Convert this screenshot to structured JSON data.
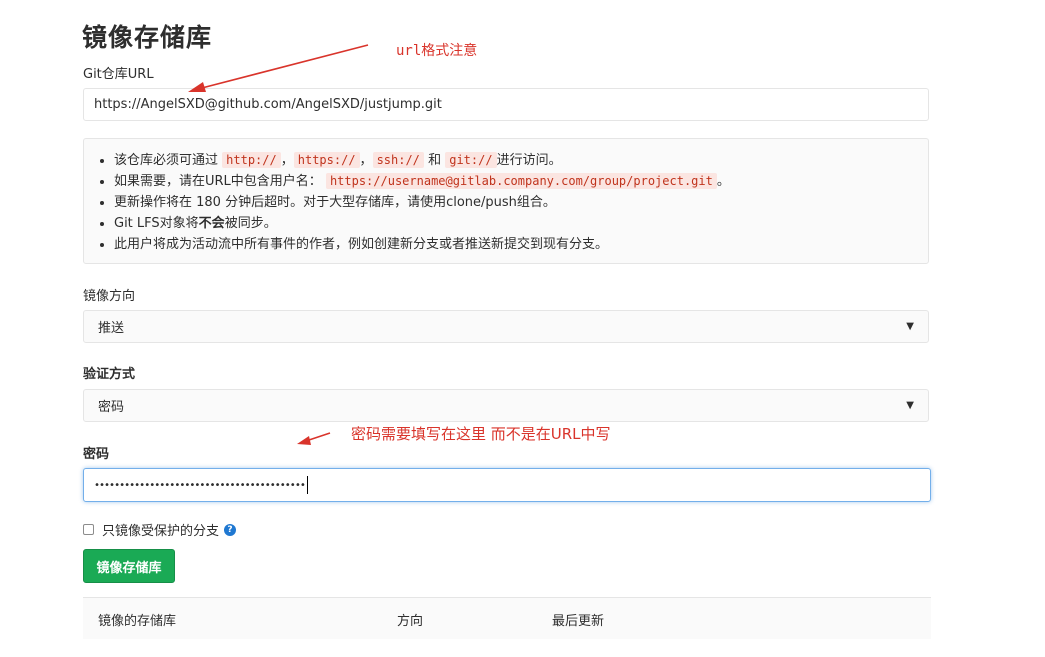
{
  "page_title": "镜像存储库",
  "git_url": {
    "label": "Git仓库URL",
    "value": "https://AngelSXD@github.com/AngelSXD/justjump.git"
  },
  "info": {
    "line1_prefix": "该仓库必须可通过",
    "line1_code1": "http://",
    "line1_sep1": "，",
    "line1_code2": "https://",
    "line1_sep2": "，",
    "line1_code3": "ssh://",
    "line1_and": "和",
    "line1_code4": "git://",
    "line1_suffix": "进行访问。",
    "line2_prefix": "如果需要，请在URL中包含用户名：",
    "line2_code": "https://username@gitlab.company.com/group/project.git",
    "line2_suffix": "。",
    "line3": "更新操作将在 180 分钟后超时。对于大型存储库，请使用clone/push组合。",
    "line4_prefix": "Git LFS对象将",
    "line4_bold": "不会",
    "line4_suffix": "被同步。",
    "line5": "此用户将成为活动流中所有事件的作者，例如创建新分支或者推送新提交到现有分支。"
  },
  "direction": {
    "label": "镜像方向",
    "value": "推送"
  },
  "auth": {
    "label": "验证方式",
    "value": "密码"
  },
  "password": {
    "label": "密码",
    "masked_value": "••••••••••••••••••••••••••••••••••••••••••"
  },
  "protected_only": {
    "label": "只镜像受保护的分支"
  },
  "submit_label": "镜像存储库",
  "table": {
    "columns": [
      "镜像的存储库",
      "方向",
      "最后更新"
    ]
  },
  "annotations": {
    "url_note": "url格式注意",
    "password_note": "密码需要填写在这里   而不是在URL中写"
  },
  "colors": {
    "primary_button": "#1aaa55",
    "annotation_red": "#d9342b",
    "code_text": "#c0341d",
    "code_bg": "#fbe5e1",
    "focus_border": "#73afea",
    "help_icon": "#1f78d1"
  }
}
